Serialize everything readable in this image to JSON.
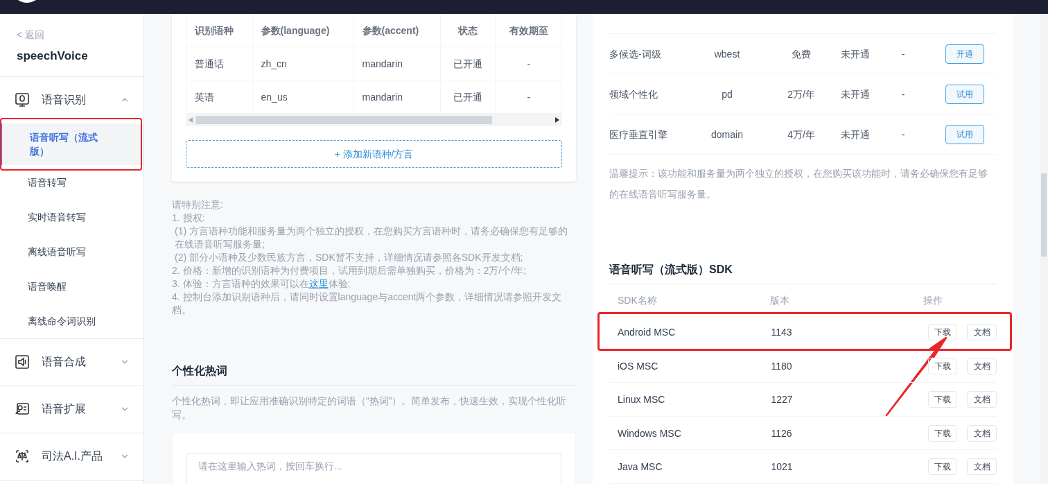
{
  "sidebar": {
    "back": "< 返回",
    "app_name": "speechVoice",
    "groups": [
      {
        "label": "语音识别",
        "expanded": true,
        "items": [
          {
            "label": "语音听写（流式版）",
            "selected": true,
            "highlighted": true
          },
          {
            "label": "语音转写",
            "selected": false,
            "highlighted": false
          },
          {
            "label": "实时语音转写",
            "selected": false,
            "highlighted": false
          },
          {
            "label": "离线语音听写",
            "selected": false,
            "highlighted": false
          },
          {
            "label": "语音唤醒",
            "selected": false,
            "highlighted": false
          },
          {
            "label": "离线命令词识别",
            "selected": false,
            "highlighted": false
          }
        ]
      },
      {
        "label": "语音合成",
        "expanded": false
      },
      {
        "label": "语音扩展",
        "expanded": false
      },
      {
        "label": "司法A.I.产品",
        "expanded": false
      }
    ]
  },
  "language_table": {
    "columns": [
      "识别语种",
      "参数(language)",
      "参数(accent)",
      "状态",
      "有效期至"
    ],
    "rows": [
      [
        "普通话",
        "zh_cn",
        "mandarin",
        "已开通",
        "-"
      ],
      [
        "英语",
        "en_us",
        "mandarin",
        "已开通",
        "-"
      ]
    ],
    "add_button": "+ 添加新语种/方言"
  },
  "notes": {
    "title": "请特别注意:",
    "lines": [
      "1. 授权:",
      "(1) 方言语种功能和服务量为两个独立的授权，在您购买方言语种时，请务必确保您有足够的在线语音听写服务量;",
      "(2) 部分小语种及少数民族方言，SDK暂不支持，详细情况请参照各SDK开发文档;",
      "2. 价格：新增的识别语种为付费项目，试用到期后需单独购买，价格为：2万/个/年;"
    ],
    "line_with_link": {
      "before": "3. 体验：方言语种的效果可以在",
      "link": "这里",
      "after": "体验;"
    },
    "last_line": "4. 控制台添加识别语种后，请同时设置language与accent两个参数，详细情况请参照开发文档。"
  },
  "hotwords": {
    "title": "个性化热词",
    "description": "个性化热词，即让应用准确识别特定的词语（“热词”）。简单发布，快速生效，实现个性化听写。",
    "placeholder": "请在这里输入热词，按回车换行..."
  },
  "feature_table": {
    "rows": [
      {
        "name": "多候选-词级",
        "param": "wbest",
        "price": "免费",
        "status": "未开通",
        "expiry": "-",
        "action": "开通"
      },
      {
        "name": "领域个性化",
        "param": "pd",
        "price": "2万/年",
        "status": "未开通",
        "expiry": "-",
        "action": "试用"
      },
      {
        "name": "医疗垂直引擎",
        "param": "domain",
        "price": "4万/年",
        "status": "未开通",
        "expiry": "-",
        "action": "试用"
      }
    ],
    "tip": "温馨提示：该功能和服务量为两个独立的授权，在您购买该功能时，请务必确保您有足够的在线语音听写服务量。"
  },
  "sdk": {
    "title": "语音听写（流式版）SDK",
    "columns": [
      "SDK名称",
      "版本",
      "操作"
    ],
    "rows": [
      {
        "name": "Android MSC",
        "version": "1143",
        "download": "下载",
        "docs": "文档",
        "highlighted": true
      },
      {
        "name": "iOS MSC",
        "version": "1180",
        "download": "下载",
        "docs": "文档",
        "highlighted": false
      },
      {
        "name": "Linux MSC",
        "version": "1227",
        "download": "下载",
        "docs": "文档",
        "highlighted": false
      },
      {
        "name": "Windows MSC",
        "version": "1126",
        "download": "下载",
        "docs": "文档",
        "highlighted": false
      },
      {
        "name": "Java MSC",
        "version": "1021",
        "download": "下载",
        "docs": "文档",
        "highlighted": false
      }
    ]
  }
}
